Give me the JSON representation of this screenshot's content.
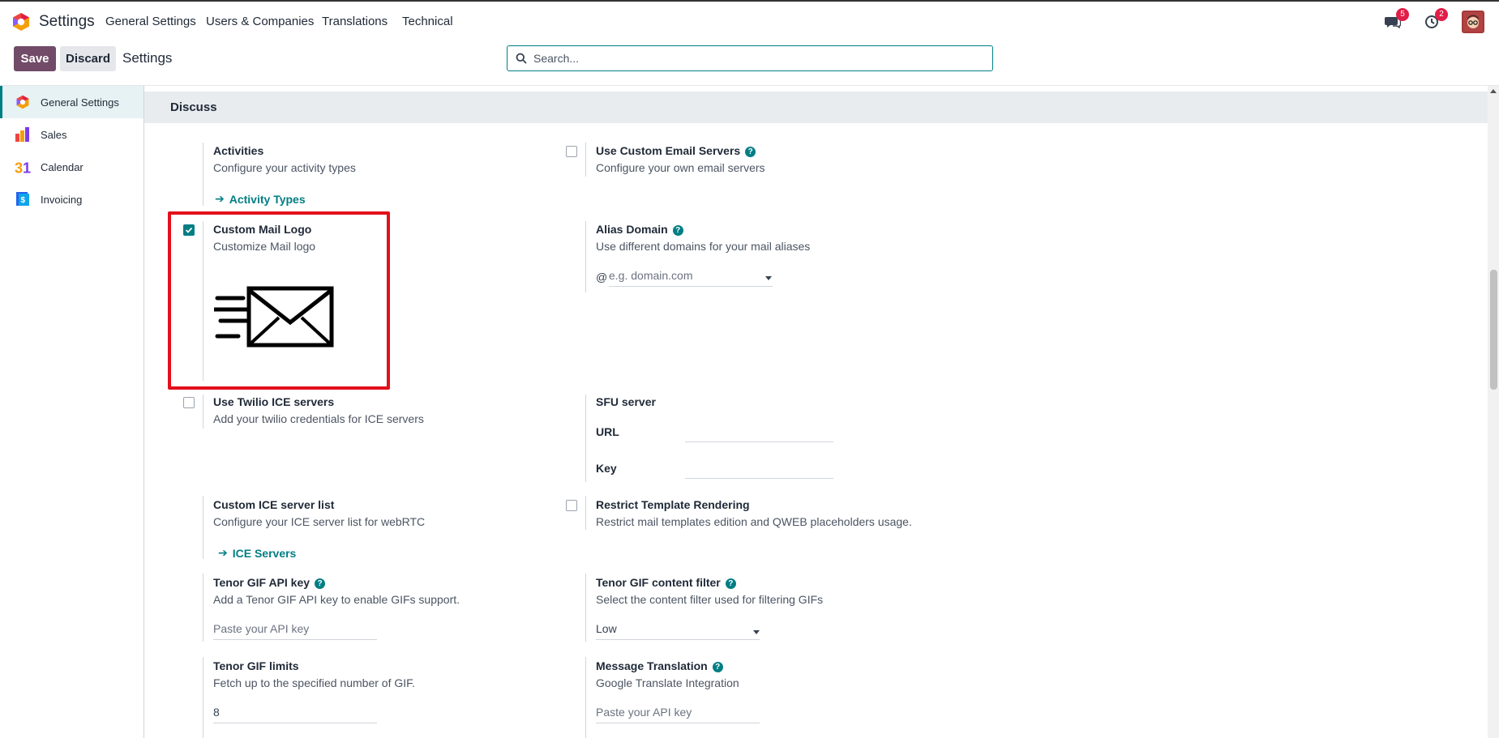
{
  "app": {
    "title": "Settings",
    "nav": [
      "General Settings",
      "Users & Companies",
      "Translations",
      "Technical"
    ],
    "messages_count": "5",
    "activities_count": "2"
  },
  "controls": {
    "save_label": "Save",
    "discard_label": "Discard",
    "breadcrumb": "Settings",
    "search_placeholder": "Search..."
  },
  "sidebar": {
    "items": [
      {
        "label": "General Settings",
        "icon": "odoo-logo-icon",
        "active": true
      },
      {
        "label": "Sales",
        "icon": "sales-chart-icon",
        "active": false
      },
      {
        "label": "Calendar",
        "icon": "calendar-icon",
        "active": false
      },
      {
        "label": "Invoicing",
        "icon": "invoice-icon",
        "active": false
      }
    ]
  },
  "section": {
    "title": "Discuss"
  },
  "settings": {
    "activities": {
      "title": "Activities",
      "desc": "Configure your activity types",
      "link": "Activity Types"
    },
    "custom_email_servers": {
      "title": "Use Custom Email Servers",
      "desc": "Configure your own email servers",
      "checked": false
    },
    "custom_mail_logo": {
      "title": "Custom Mail Logo",
      "desc": "Customize Mail logo",
      "checked": true
    },
    "alias_domain": {
      "title": "Alias Domain",
      "desc": "Use different domains for your mail aliases",
      "prefix": "@",
      "placeholder": "e.g. domain.com"
    },
    "twilio": {
      "title": "Use Twilio ICE servers",
      "desc": "Add your twilio credentials for ICE servers",
      "checked": false
    },
    "sfu": {
      "title": "SFU server",
      "url_label": "URL",
      "key_label": "Key"
    },
    "ice_list": {
      "title": "Custom ICE server list",
      "desc": "Configure your ICE server list for webRTC",
      "link": "ICE Servers"
    },
    "restrict_template": {
      "title": "Restrict Template Rendering",
      "desc": "Restrict mail templates edition and QWEB placeholders usage.",
      "checked": false
    },
    "tenor_key": {
      "title": "Tenor GIF API key",
      "desc": "Add a Tenor GIF API key to enable GIFs support.",
      "placeholder": "Paste your API key"
    },
    "tenor_filter": {
      "title": "Tenor GIF content filter",
      "desc": "Select the content filter used for filtering GIFs",
      "value": "Low"
    },
    "tenor_limits": {
      "title": "Tenor GIF limits",
      "desc": "Fetch up to the specified number of GIF.",
      "value": "8"
    },
    "translation": {
      "title": "Message Translation",
      "desc": "Google Translate Integration",
      "placeholder": "Paste your API key"
    }
  },
  "colors": {
    "brand": "#714b67",
    "accent": "#017e84",
    "highlight": "#e3101b"
  }
}
